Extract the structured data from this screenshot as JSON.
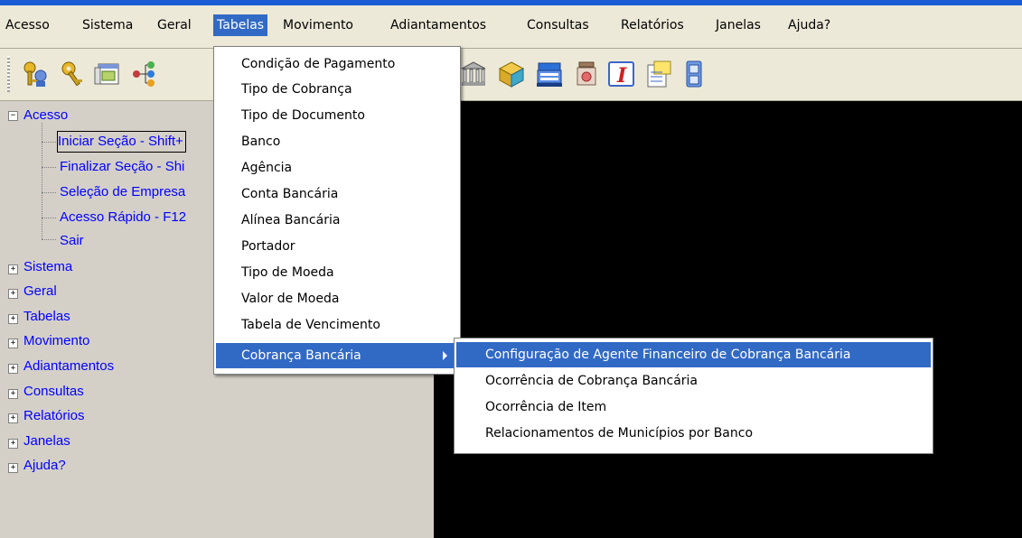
{
  "menubar": {
    "items": [
      "Acesso",
      "Sistema",
      "Geral",
      "Tabelas",
      "Movimento",
      "Adiantamentos",
      "Consultas",
      "Relatórios",
      "Janelas",
      "Ajuda?"
    ],
    "active": "Tabelas"
  },
  "toolbar": {
    "icons": [
      "keys-user-icon",
      "keys-icon",
      "window-icon",
      "tree-network-icon",
      "bank-icon",
      "package-icon",
      "cash-register-icon",
      "jar-icon",
      "italic-i-icon",
      "notes-icon",
      "cabinet-icon"
    ]
  },
  "tree": {
    "root": "Acesso",
    "children": [
      "Iniciar Seção - Shift+",
      "Finalizar Seção - Shi",
      "Seleção de Empresa",
      "Acesso Rápido - F12",
      "Sair"
    ],
    "others": [
      "Sistema",
      "Geral",
      "Tabelas",
      "Movimento",
      "Adiantamentos",
      "Consultas",
      "Relatórios",
      "Janelas",
      "Ajuda?"
    ]
  },
  "menu": {
    "items": [
      "Condição de Pagamento",
      "Tipo de Cobrança",
      "Tipo de Documento",
      "Banco",
      "Agência",
      "Conta Bancária",
      "Alínea Bancária",
      "Portador",
      "Tipo de Moeda",
      "Valor de Moeda",
      "Tabela de Vencimento",
      "Cobrança Bancária"
    ],
    "selected": "Cobrança Bancária"
  },
  "submenu": {
    "items": [
      "Configuração de Agente Financeiro de Cobrança Bancária",
      "Ocorrência de Cobrança Bancária",
      "Ocorrência de Item",
      "Relacionamentos de Municípios por Banco"
    ],
    "selected": "Configuração de Agente Financeiro de Cobrança Bancária"
  },
  "colors": {
    "highlight": "#316AC5",
    "tree_text": "#0000FF",
    "content_bg": "#000000"
  }
}
